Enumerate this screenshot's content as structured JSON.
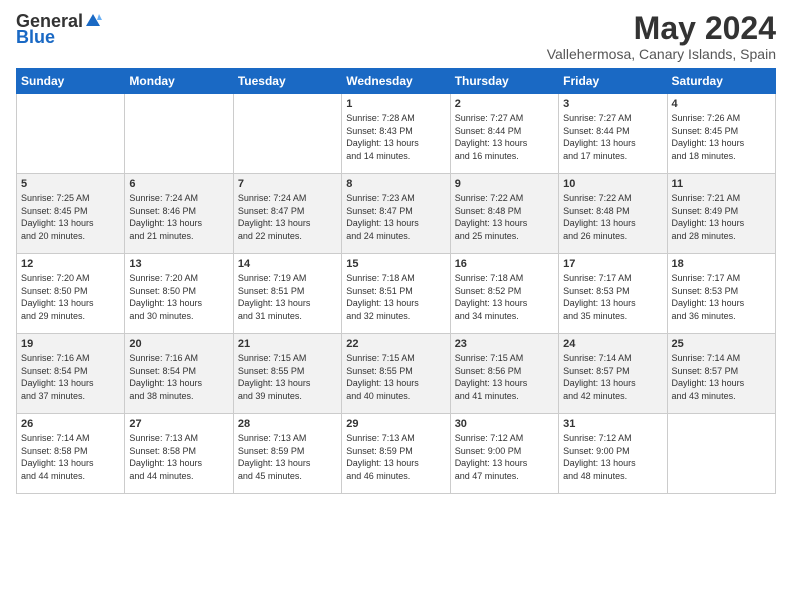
{
  "logo": {
    "general": "General",
    "blue": "Blue"
  },
  "title": "May 2024",
  "location": "Vallehermosa, Canary Islands, Spain",
  "weekdays": [
    "Sunday",
    "Monday",
    "Tuesday",
    "Wednesday",
    "Thursday",
    "Friday",
    "Saturday"
  ],
  "weeks": [
    [
      {
        "day": "",
        "info": ""
      },
      {
        "day": "",
        "info": ""
      },
      {
        "day": "",
        "info": ""
      },
      {
        "day": "1",
        "info": "Sunrise: 7:28 AM\nSunset: 8:43 PM\nDaylight: 13 hours\nand 14 minutes."
      },
      {
        "day": "2",
        "info": "Sunrise: 7:27 AM\nSunset: 8:44 PM\nDaylight: 13 hours\nand 16 minutes."
      },
      {
        "day": "3",
        "info": "Sunrise: 7:27 AM\nSunset: 8:44 PM\nDaylight: 13 hours\nand 17 minutes."
      },
      {
        "day": "4",
        "info": "Sunrise: 7:26 AM\nSunset: 8:45 PM\nDaylight: 13 hours\nand 18 minutes."
      }
    ],
    [
      {
        "day": "5",
        "info": "Sunrise: 7:25 AM\nSunset: 8:45 PM\nDaylight: 13 hours\nand 20 minutes."
      },
      {
        "day": "6",
        "info": "Sunrise: 7:24 AM\nSunset: 8:46 PM\nDaylight: 13 hours\nand 21 minutes."
      },
      {
        "day": "7",
        "info": "Sunrise: 7:24 AM\nSunset: 8:47 PM\nDaylight: 13 hours\nand 22 minutes."
      },
      {
        "day": "8",
        "info": "Sunrise: 7:23 AM\nSunset: 8:47 PM\nDaylight: 13 hours\nand 24 minutes."
      },
      {
        "day": "9",
        "info": "Sunrise: 7:22 AM\nSunset: 8:48 PM\nDaylight: 13 hours\nand 25 minutes."
      },
      {
        "day": "10",
        "info": "Sunrise: 7:22 AM\nSunset: 8:48 PM\nDaylight: 13 hours\nand 26 minutes."
      },
      {
        "day": "11",
        "info": "Sunrise: 7:21 AM\nSunset: 8:49 PM\nDaylight: 13 hours\nand 28 minutes."
      }
    ],
    [
      {
        "day": "12",
        "info": "Sunrise: 7:20 AM\nSunset: 8:50 PM\nDaylight: 13 hours\nand 29 minutes."
      },
      {
        "day": "13",
        "info": "Sunrise: 7:20 AM\nSunset: 8:50 PM\nDaylight: 13 hours\nand 30 minutes."
      },
      {
        "day": "14",
        "info": "Sunrise: 7:19 AM\nSunset: 8:51 PM\nDaylight: 13 hours\nand 31 minutes."
      },
      {
        "day": "15",
        "info": "Sunrise: 7:18 AM\nSunset: 8:51 PM\nDaylight: 13 hours\nand 32 minutes."
      },
      {
        "day": "16",
        "info": "Sunrise: 7:18 AM\nSunset: 8:52 PM\nDaylight: 13 hours\nand 34 minutes."
      },
      {
        "day": "17",
        "info": "Sunrise: 7:17 AM\nSunset: 8:53 PM\nDaylight: 13 hours\nand 35 minutes."
      },
      {
        "day": "18",
        "info": "Sunrise: 7:17 AM\nSunset: 8:53 PM\nDaylight: 13 hours\nand 36 minutes."
      }
    ],
    [
      {
        "day": "19",
        "info": "Sunrise: 7:16 AM\nSunset: 8:54 PM\nDaylight: 13 hours\nand 37 minutes."
      },
      {
        "day": "20",
        "info": "Sunrise: 7:16 AM\nSunset: 8:54 PM\nDaylight: 13 hours\nand 38 minutes."
      },
      {
        "day": "21",
        "info": "Sunrise: 7:15 AM\nSunset: 8:55 PM\nDaylight: 13 hours\nand 39 minutes."
      },
      {
        "day": "22",
        "info": "Sunrise: 7:15 AM\nSunset: 8:55 PM\nDaylight: 13 hours\nand 40 minutes."
      },
      {
        "day": "23",
        "info": "Sunrise: 7:15 AM\nSunset: 8:56 PM\nDaylight: 13 hours\nand 41 minutes."
      },
      {
        "day": "24",
        "info": "Sunrise: 7:14 AM\nSunset: 8:57 PM\nDaylight: 13 hours\nand 42 minutes."
      },
      {
        "day": "25",
        "info": "Sunrise: 7:14 AM\nSunset: 8:57 PM\nDaylight: 13 hours\nand 43 minutes."
      }
    ],
    [
      {
        "day": "26",
        "info": "Sunrise: 7:14 AM\nSunset: 8:58 PM\nDaylight: 13 hours\nand 44 minutes."
      },
      {
        "day": "27",
        "info": "Sunrise: 7:13 AM\nSunset: 8:58 PM\nDaylight: 13 hours\nand 44 minutes."
      },
      {
        "day": "28",
        "info": "Sunrise: 7:13 AM\nSunset: 8:59 PM\nDaylight: 13 hours\nand 45 minutes."
      },
      {
        "day": "29",
        "info": "Sunrise: 7:13 AM\nSunset: 8:59 PM\nDaylight: 13 hours\nand 46 minutes."
      },
      {
        "day": "30",
        "info": "Sunrise: 7:12 AM\nSunset: 9:00 PM\nDaylight: 13 hours\nand 47 minutes."
      },
      {
        "day": "31",
        "info": "Sunrise: 7:12 AM\nSunset: 9:00 PM\nDaylight: 13 hours\nand 48 minutes."
      },
      {
        "day": "",
        "info": ""
      }
    ]
  ]
}
